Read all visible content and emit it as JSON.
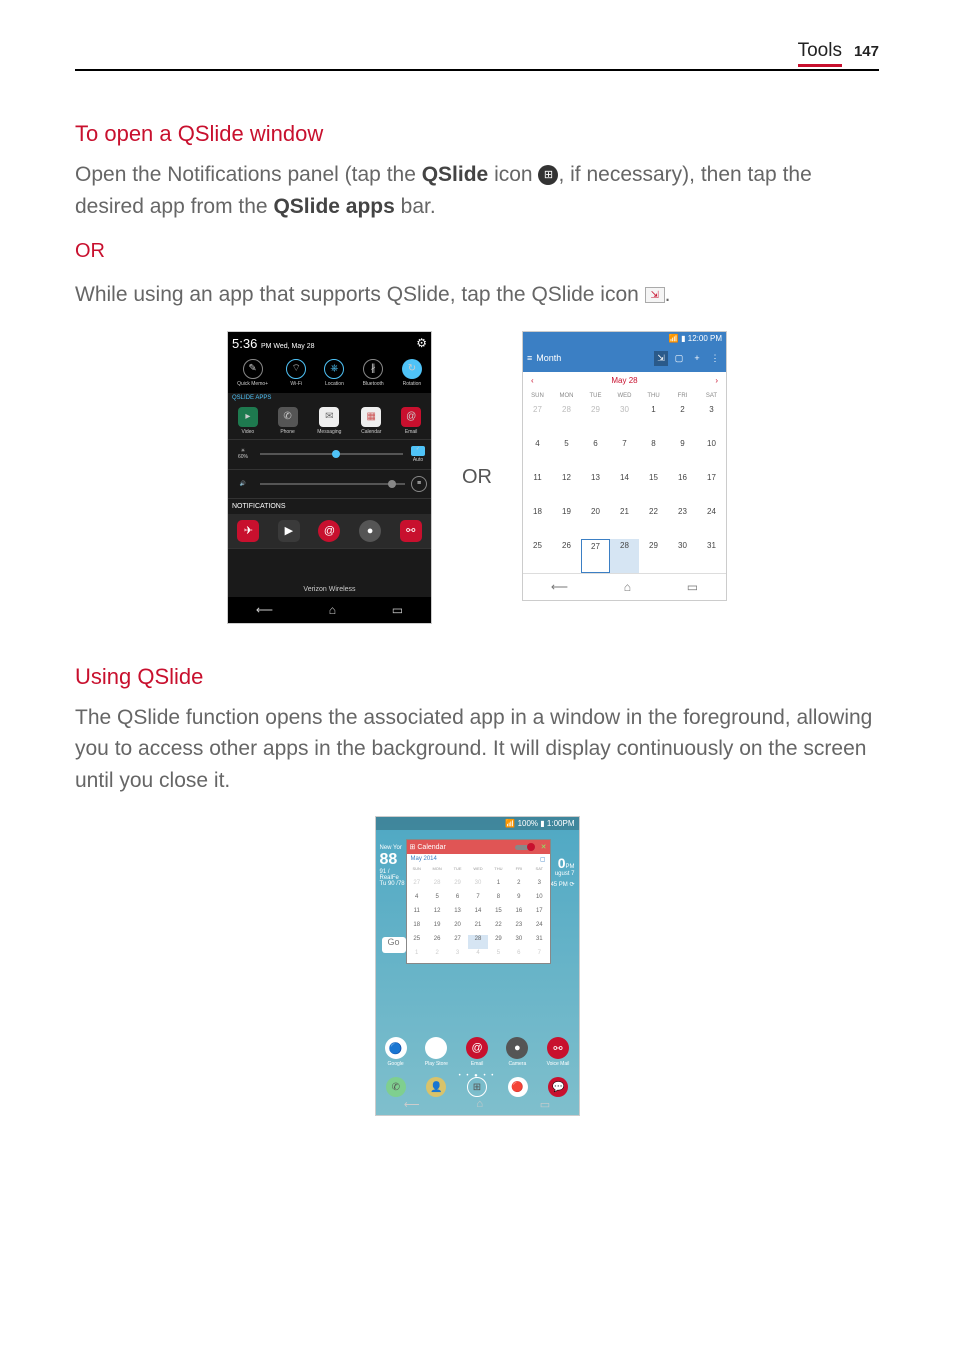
{
  "header": {
    "section": "Tools",
    "page": "147"
  },
  "sec1": {
    "title": "To open a QSlide window",
    "p1a": "Open the Notifications panel (tap the ",
    "p1b": "QSlide",
    "p1c": " icon ",
    "p1d": ", if necessary), then tap the desired app from the ",
    "p1e": "QSlide apps",
    "p1f": " bar.",
    "or": "OR",
    "p2a": "While using an app that supports QSlide, tap the QSlide icon ",
    "p2b": "."
  },
  "figOr": "OR",
  "phone1": {
    "time": "5:36",
    "timeSuffix": "PM  Wed, May 28",
    "toggles": [
      "Quick Memo+",
      "Wi-Fi",
      "Location",
      "Bluetooth",
      "Rotation"
    ],
    "qslideLabel": "QSLIDE APPS",
    "qslideApps": [
      "Video",
      "Phone",
      "Messaging",
      "Calendar",
      "Email"
    ],
    "brightness": "60%",
    "brightnessAuto": "Auto",
    "notifLabel": "NOTIFICATIONS",
    "carrier": "Verizon Wireless"
  },
  "phone2": {
    "statusTime": "12:00 PM",
    "viewLabel": "Month",
    "monthLabel": "May 28",
    "days": [
      "SUN",
      "MON",
      "TUE",
      "WED",
      "THU",
      "FRI",
      "SAT"
    ],
    "cells": [
      [
        "27",
        "28",
        "29",
        "30",
        "1",
        "2",
        "3"
      ],
      [
        "4",
        "5",
        "6",
        "7",
        "8",
        "9",
        "10"
      ],
      [
        "11",
        "12",
        "13",
        "14",
        "15",
        "16",
        "17"
      ],
      [
        "18",
        "19",
        "20",
        "21",
        "22",
        "23",
        "24"
      ],
      [
        "25",
        "26",
        "27",
        "28",
        "29",
        "30",
        "31"
      ]
    ]
  },
  "sec2": {
    "title": "Using QSlide",
    "p1": "The QSlide function opens the associated app in a window in the foreground, allowing you to access other apps in the background. It will display continuously on the screen until you close it."
  },
  "phone3": {
    "statusTime": "1:00PM",
    "statusBatt": "100%",
    "leftCity": "New Yor",
    "leftTemp": "88",
    "leftCond": "91 / RealFe",
    "leftNext": "Tu 90 /78",
    "overlayTitle": "Calendar",
    "overlayMonth": "May 2014",
    "rightTime": "0",
    "rightPM": "PM",
    "rightDate": "ugust 7",
    "rightAlarm": "45 PM",
    "days": [
      "SUN",
      "MON",
      "TUE",
      "WED",
      "THU",
      "FRI",
      "SAT"
    ],
    "cells": [
      [
        "27",
        "28",
        "29",
        "30",
        "1",
        "2",
        "3"
      ],
      [
        "4",
        "5",
        "6",
        "7",
        "8",
        "9",
        "10"
      ],
      [
        "11",
        "12",
        "13",
        "14",
        "15",
        "16",
        "17"
      ],
      [
        "18",
        "19",
        "20",
        "21",
        "22",
        "23",
        "24"
      ],
      [
        "25",
        "26",
        "27",
        "28",
        "29",
        "30",
        "31"
      ],
      [
        "1",
        "2",
        "3",
        "4",
        "5",
        "6",
        "7"
      ]
    ],
    "googleBtn": "Go",
    "homeApps": [
      "Google",
      "Play Store",
      "Email",
      "Camera",
      "Voice Mail"
    ]
  }
}
